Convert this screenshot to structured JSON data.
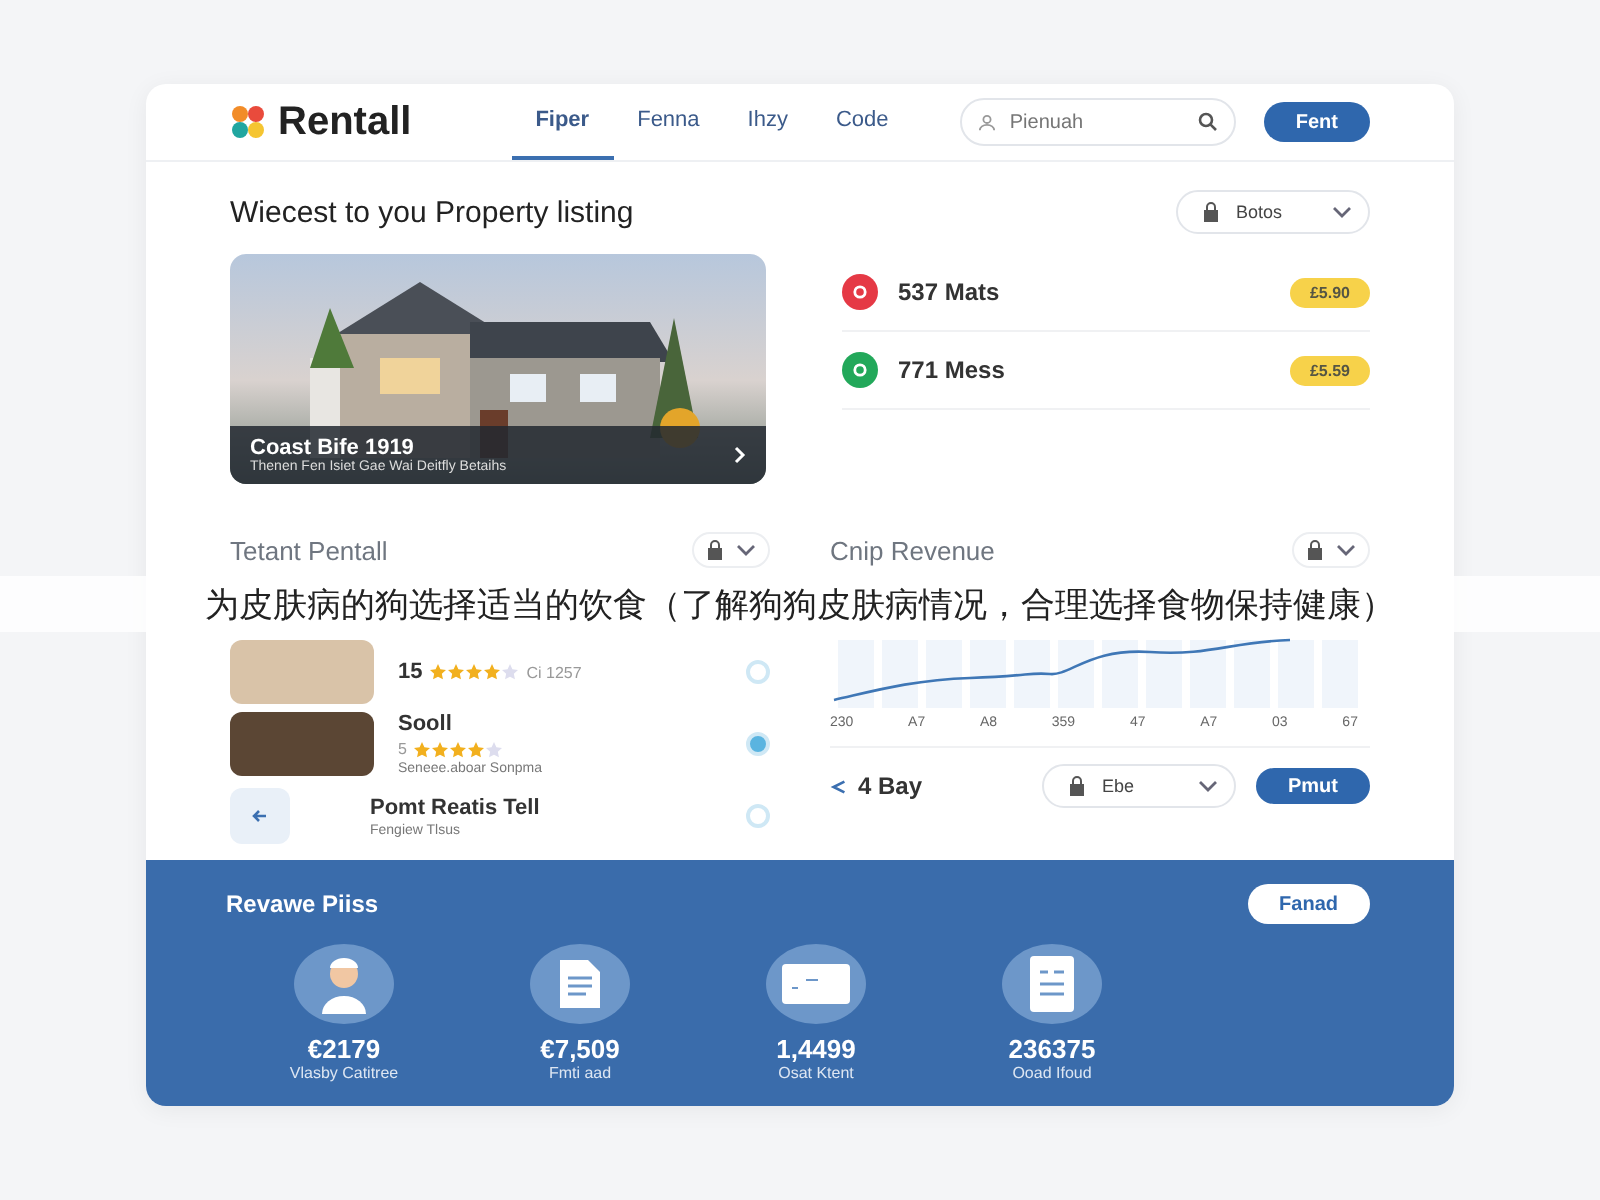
{
  "header": {
    "logo": "Rentall",
    "nav": [
      {
        "label": "Fiper",
        "selected": true
      },
      {
        "label": "Fenna",
        "selected": false
      },
      {
        "label": "Ihzy",
        "selected": false
      },
      {
        "label": "Code",
        "selected": false
      }
    ],
    "search": {
      "placeholder": "Pienuah"
    },
    "button": "Fent"
  },
  "listing": {
    "title": "Wiecest to you Property listing",
    "filter": "Botos",
    "photo": {
      "title": "Coast Bife 1919",
      "subtitle": "Thenen Fen Isiet Gae Wai Deitfly Betaihs"
    },
    "stats": [
      {
        "label": "537 Mats",
        "badge": "£5.90",
        "color": "#e53945"
      },
      {
        "label": "771 Mess",
        "badge": "£5.59",
        "color": "#22a85a"
      }
    ]
  },
  "tenants": {
    "title": "Tetant Pentall",
    "items": [
      {
        "kind": "person",
        "title": "15",
        "stars": 4,
        "meta": "Ci 1257",
        "selected": false
      },
      {
        "kind": "room",
        "title": "Sooll",
        "prefix": "5",
        "stars": 4,
        "meta": "Seneee.aboar Sonpma",
        "selected": true
      },
      {
        "kind": "add",
        "title": "Pomt Reatis Tell",
        "meta": "Fengiew Tlsus",
        "selected": false
      }
    ]
  },
  "revenue": {
    "title": "Cnip Revenue",
    "x_labels": [
      "230",
      "A7",
      "A8",
      "359",
      "47",
      "A7",
      "03",
      "67"
    ],
    "period": "4 Bay",
    "dropdown": "Ebe",
    "button": "Pmut"
  },
  "summary": {
    "title": "Revawe Piiss",
    "button": "Fanad",
    "items": [
      {
        "kind": "person",
        "value": "€2179",
        "label": "Vlasby Catitree"
      },
      {
        "kind": "document",
        "value": "€7,509",
        "label": "Fmti aad"
      },
      {
        "kind": "card",
        "value": "1,4499",
        "label": "Osat Ktent"
      },
      {
        "kind": "report",
        "value": "236375",
        "label": "Ooad Ifoud"
      }
    ]
  },
  "caption": "为皮肤病的狗选择适当的饮食（了解狗狗皮肤病情况，合理选择食物保持健康）"
}
